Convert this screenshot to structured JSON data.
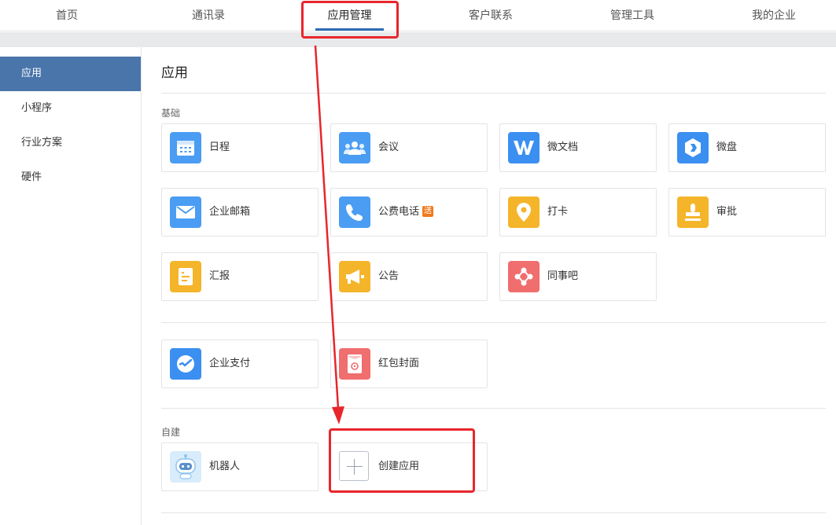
{
  "top_nav": {
    "tabs": [
      {
        "label": "首页"
      },
      {
        "label": "通讯录"
      },
      {
        "label": "应用管理"
      },
      {
        "label": "客户联系"
      },
      {
        "label": "管理工具"
      },
      {
        "label": "我的企业"
      }
    ],
    "active": "应用管理"
  },
  "sidebar": {
    "items": [
      {
        "label": "应用"
      },
      {
        "label": "小程序"
      },
      {
        "label": "行业方案"
      },
      {
        "label": "硬件"
      }
    ],
    "active": "应用"
  },
  "main": {
    "title": "应用",
    "sections": {
      "basic": {
        "label": "基础",
        "apps": [
          {
            "label": "日程",
            "icon": "calendar-icon",
            "color": "#4a9df3"
          },
          {
            "label": "会议",
            "icon": "meeting-people-icon",
            "color": "#4a9df3"
          },
          {
            "label": "微文档",
            "icon": "w-document-icon",
            "color": "#3b8ff0"
          },
          {
            "label": "微盘",
            "icon": "cloud-drive-icon",
            "color": "#3b8ff0"
          },
          {
            "label": "企业邮箱",
            "icon": "mail-icon",
            "color": "#4a9df3"
          },
          {
            "label": "公费电话",
            "icon": "phone-icon",
            "color": "#4a9df3",
            "badge": "送"
          },
          {
            "label": "打卡",
            "icon": "location-pin-icon",
            "color": "#f5b52a"
          },
          {
            "label": "审批",
            "icon": "stamp-icon",
            "color": "#f5b52a"
          },
          {
            "label": "汇报",
            "icon": "report-document-icon",
            "color": "#f5b52a"
          },
          {
            "label": "公告",
            "icon": "megaphone-icon",
            "color": "#f5b52a"
          },
          {
            "label": "同事吧",
            "icon": "share-nodes-icon",
            "color": "#f06e6e"
          }
        ]
      },
      "payment": {
        "apps": [
          {
            "label": "企业支付",
            "icon": "payment-icon",
            "color": "#3b8ff0"
          },
          {
            "label": "红包封面",
            "icon": "red-envelope-icon",
            "color": "#f06e6e"
          }
        ]
      },
      "custom": {
        "label": "自建",
        "apps": [
          {
            "label": "机器人",
            "icon": "robot-icon",
            "color": "#d8ecfb"
          },
          {
            "label": "创建应用",
            "icon": "plus-icon",
            "color": "#ffffff"
          }
        ]
      }
    }
  },
  "annotation": {
    "highlight_color": "#e8262b"
  }
}
